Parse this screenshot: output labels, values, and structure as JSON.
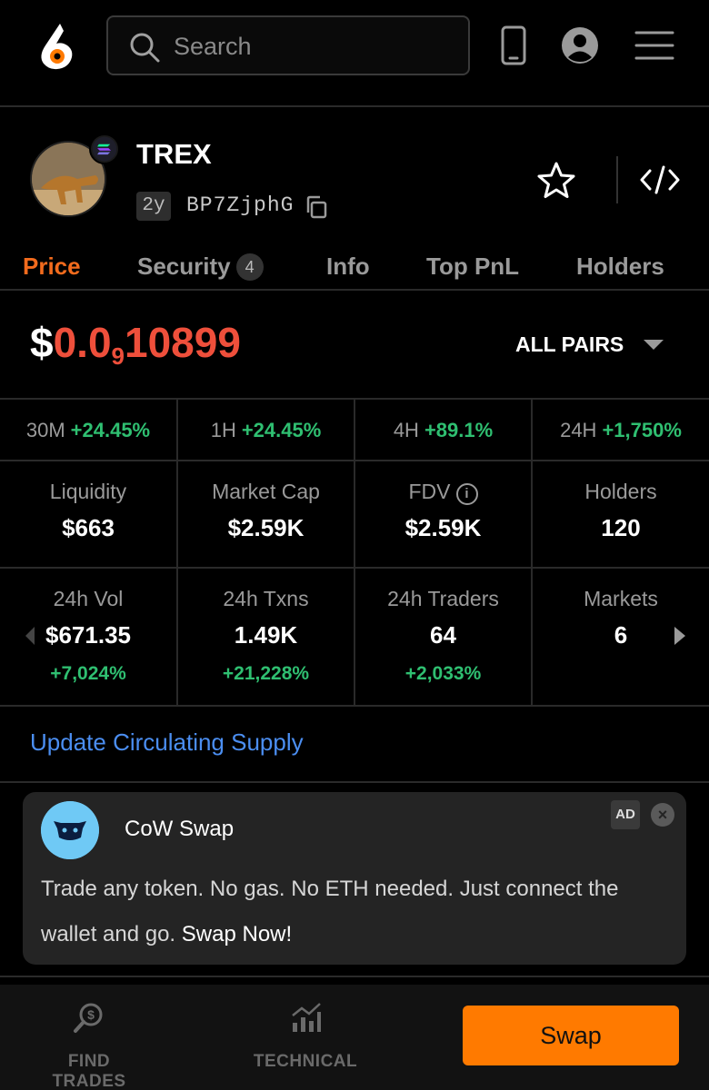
{
  "header": {
    "search_placeholder": "Search"
  },
  "token": {
    "name": "TREX",
    "age": "2y",
    "address": "BP7ZjphG"
  },
  "tabs": [
    {
      "label": "Price",
      "active": true
    },
    {
      "label": "Security",
      "badge": "4"
    },
    {
      "label": "Info"
    },
    {
      "label": "Top PnL"
    },
    {
      "label": "Holders"
    }
  ],
  "price": {
    "dollar": "$",
    "lead": "0.0",
    "zeros_subscript": "9",
    "digits": "10899",
    "pairs_label": "ALL PAIRS"
  },
  "timeframes": [
    {
      "label": "30M",
      "change": "+24.45%"
    },
    {
      "label": "1H",
      "change": "+24.45%"
    },
    {
      "label": "4H",
      "change": "+89.1%"
    },
    {
      "label": "24H",
      "change": "+1,750%"
    }
  ],
  "stats": [
    {
      "label": "Liquidity",
      "value": "$663"
    },
    {
      "label": "Market Cap",
      "value": "$2.59K"
    },
    {
      "label": "FDV",
      "value": "$2.59K"
    },
    {
      "label": "Holders",
      "value": "120"
    }
  ],
  "stats24": [
    {
      "label": "24h Vol",
      "value": "$671.35",
      "change": "+7,024%"
    },
    {
      "label": "24h Txns",
      "value": "1.49K",
      "change": "+21,228%"
    },
    {
      "label": "24h Traders",
      "value": "64",
      "change": "+2,033%"
    },
    {
      "label": "Markets",
      "value": "6"
    }
  ],
  "update_supply_link": "Update Circulating Supply",
  "ad": {
    "name": "CoW Swap",
    "badge": "AD",
    "text": "Trade any token. No gas. No ETH needed. Just connect the wallet and go.",
    "cta": "Swap Now!"
  },
  "bottom_bar": {
    "find_trades": "FIND TRADES",
    "technical": "TECHNICAL",
    "swap": "Swap"
  },
  "colors": {
    "accent": "#f26b1d",
    "price": "#ee4f3b",
    "positive": "#2fbf71",
    "link": "#4b8ef1",
    "swap_button": "#ff7a00"
  }
}
